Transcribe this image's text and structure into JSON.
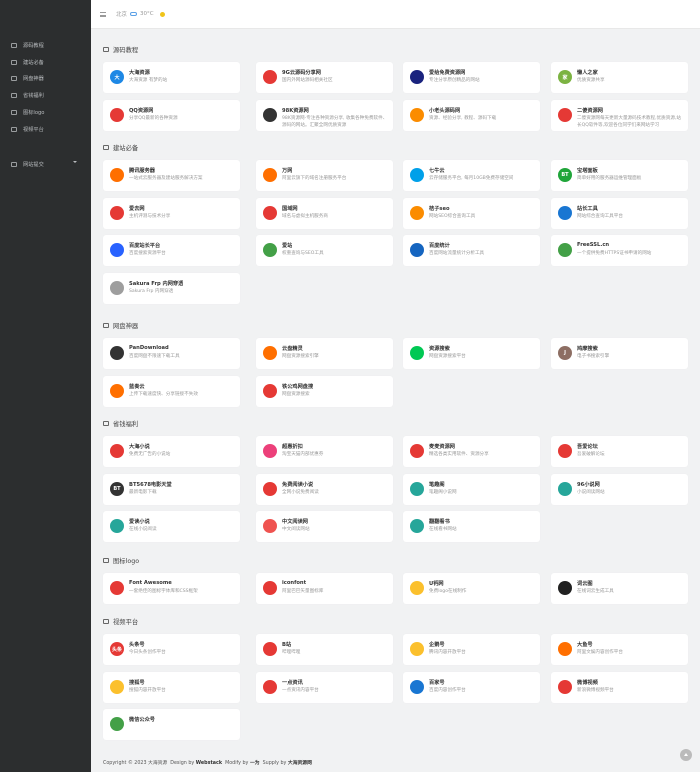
{
  "sidebar": {
    "items": [
      {
        "label": "源码教程",
        "icon": "book-icon"
      },
      {
        "label": "建站必备",
        "icon": "tools-icon"
      },
      {
        "label": "网盘神器",
        "icon": "cloud-icon"
      },
      {
        "label": "省钱福利",
        "icon": "money-icon"
      },
      {
        "label": "图标logo",
        "icon": "image-icon"
      },
      {
        "label": "视频平台",
        "icon": "video-icon"
      },
      {
        "label": "网站提交",
        "icon": "link-icon"
      }
    ]
  },
  "topbar": {
    "city": "北京",
    "temp": "30°C"
  },
  "sections": [
    {
      "title": "源码教程",
      "cards": [
        {
          "name": "大海资源",
          "desc": "大海资源 有梦的站",
          "logo": "大",
          "color": "#1e88e5"
        },
        {
          "name": "9G云源码分享网",
          "desc": "国内外网站源码相关社区",
          "logo": "",
          "color": "#e53935"
        },
        {
          "name": "爱给免费资源网",
          "desc": "专注分享原创精品的网站",
          "logo": "",
          "color": "#1a237e"
        },
        {
          "name": "懒人之家",
          "desc": "优质资源共享",
          "logo": "家",
          "color": "#7cb342"
        },
        {
          "name": "QQ资源网",
          "desc": "分享QQ最新的各种资源",
          "logo": "",
          "color": "#e53935"
        },
        {
          "name": "98K资源网",
          "desc": "98K资源网-专注各种资源分享, 收集各种免费软件、源码的网站。汇聚全网优质资源",
          "logo": "",
          "color": "#333333"
        },
        {
          "name": "小老头源码网",
          "desc": "资源、经验分享, 教程、源码下载",
          "logo": "",
          "color": "#fb8c00"
        },
        {
          "name": "二傻资源网",
          "desc": "二傻资源网每天更新大量源码技术教程,优质资源,站长QQ软件等,欢迎各位同学们来网站学习",
          "logo": "",
          "color": "#e53935"
        }
      ]
    },
    {
      "title": "建站必备",
      "cards": [
        {
          "name": "腾讯服务器",
          "desc": "一站式云服务器及建站服务解决方案",
          "logo": "",
          "color": "#ff6f00"
        },
        {
          "name": "万网",
          "desc": "阿里云旗下的域名注册服务平台",
          "logo": "",
          "color": "#ff6f00"
        },
        {
          "name": "七牛云",
          "desc": "云存储服务平台, 每月10GB免费存储空间",
          "logo": "",
          "color": "#00a0e9"
        },
        {
          "name": "宝塔面板",
          "desc": "简单好用的服务器运维管理面板",
          "logo": "BT",
          "color": "#20a53a"
        },
        {
          "name": "爱去网",
          "desc": "主机评测与技术分享",
          "logo": "",
          "color": "#e53935"
        },
        {
          "name": "国域网",
          "desc": "域名与虚拟主机服务商",
          "logo": "",
          "color": "#e53935"
        },
        {
          "name": "桔子seo",
          "desc": "网站SEO综合查询工具",
          "logo": "",
          "color": "#fb8c00"
        },
        {
          "name": "站长工具",
          "desc": "网站综合查询工具平台",
          "logo": "",
          "color": "#1976d2"
        },
        {
          "name": "百度站长平台",
          "desc": "百度搜索资源平台",
          "logo": "",
          "color": "#2962ff"
        },
        {
          "name": "爱站",
          "desc": "权重查询与SEO工具",
          "logo": "",
          "color": "#43a047"
        },
        {
          "name": "百度统计",
          "desc": "百度网站流量统计分析工具",
          "logo": "",
          "color": "#1565c0"
        },
        {
          "name": "FreeSSL.cn",
          "desc": "一个提供免费HTTPS证书申请的网站",
          "logo": "",
          "color": "#43a047"
        },
        {
          "name": "Sakura Frp 内网穿透",
          "desc": "Sakura Frp 内网穿透",
          "logo": "",
          "color": "#9e9e9e"
        }
      ]
    },
    {
      "title": "网盘神器",
      "cards": [
        {
          "name": "PanDownload",
          "desc": "百度网盘不限速下载工具",
          "logo": "",
          "color": "#333333"
        },
        {
          "name": "云盘精灵",
          "desc": "网盘资源搜索引擎",
          "logo": "",
          "color": "#ff6f00"
        },
        {
          "name": "资源搜索",
          "desc": "网盘资源搜索平台",
          "logo": "",
          "color": "#00c853"
        },
        {
          "name": "鸠摩搜索",
          "desc": "电子书搜索引擎",
          "logo": "J",
          "color": "#8d6e63"
        },
        {
          "name": "蓝奏云",
          "desc": "上传下载速度快、分享链接不失效",
          "logo": "",
          "color": "#ff6f00"
        },
        {
          "name": "铁公鸡网盘搜",
          "desc": "网盘资源搜索",
          "logo": "",
          "color": "#e53935"
        }
      ]
    },
    {
      "title": "省钱福利",
      "cards": [
        {
          "name": "大海小说",
          "desc": "免费无广告的小说站",
          "logo": "",
          "color": "#e53935"
        },
        {
          "name": "超惠折扣",
          "desc": "淘宝天猫内部优惠券",
          "logo": "",
          "color": "#ec407a"
        },
        {
          "name": "麦麦资源网",
          "desc": "精选各类实用软件、资源分享",
          "logo": "",
          "color": "#e53935"
        },
        {
          "name": "吾爱论坛",
          "desc": "吾爱破解论坛",
          "logo": "",
          "color": "#e53935"
        },
        {
          "name": "BT5678电影天堂",
          "desc": "最新电影下载",
          "logo": "BT",
          "color": "#333333"
        },
        {
          "name": "免费阅读小说",
          "desc": "全网小说免费阅读",
          "logo": "",
          "color": "#e53935"
        },
        {
          "name": "笔趣阁",
          "desc": "笔趣阁小说网",
          "logo": "",
          "color": "#26a69a"
        },
        {
          "name": "96小说网",
          "desc": "小说阅读网站",
          "logo": "",
          "color": "#26a69a"
        },
        {
          "name": "爱读小说",
          "desc": "在线小说阅读",
          "logo": "",
          "color": "#26a69a"
        },
        {
          "name": "中文阅读网",
          "desc": "中文阅读网站",
          "logo": "",
          "color": "#ef5350"
        },
        {
          "name": "翻翻看书",
          "desc": "在线看书网站",
          "logo": "",
          "color": "#26a69a"
        }
      ]
    },
    {
      "title": "图标logo",
      "cards": [
        {
          "name": "Font Awesome",
          "desc": "一套绝佳的图标字体库和CSS框架",
          "logo": "",
          "color": "#e53935"
        },
        {
          "name": "iconfont",
          "desc": "阿里巴巴矢量图标库",
          "logo": "",
          "color": "#e53935"
        },
        {
          "name": "U钙网",
          "desc": "免费logo在线制作",
          "logo": "",
          "color": "#fbc02d"
        },
        {
          "name": "词云图",
          "desc": "在线词云生成工具",
          "logo": "",
          "color": "#212121"
        }
      ]
    },
    {
      "title": "视频平台",
      "cards": [
        {
          "name": "头条号",
          "desc": "今日头条创作平台",
          "logo": "头条",
          "color": "#e53935"
        },
        {
          "name": "B站",
          "desc": "哔哩哔哩",
          "logo": "",
          "color": "#e53935"
        },
        {
          "name": "企鹅号",
          "desc": "腾讯内容开放平台",
          "logo": "",
          "color": "#fbc02d"
        },
        {
          "name": "大鱼号",
          "desc": "阿里文娱内容创作平台",
          "logo": "",
          "color": "#ff6f00"
        },
        {
          "name": "搜狐号",
          "desc": "搜狐内容开放平台",
          "logo": "",
          "color": "#fbc02d"
        },
        {
          "name": "一点资讯",
          "desc": "一点资讯内容平台",
          "logo": "",
          "color": "#e53935"
        },
        {
          "name": "百家号",
          "desc": "百度内容创作平台",
          "logo": "",
          "color": "#1976d2"
        },
        {
          "name": "微博视频",
          "desc": "新浪微博视频平台",
          "logo": "",
          "color": "#e53935"
        },
        {
          "name": "微信公众号",
          "desc": "",
          "logo": "",
          "color": "#43a047"
        }
      ]
    }
  ],
  "footer": {
    "prefix": "Copyright © 2023 大海资源",
    "design": "Design by",
    "design_name": "Webstack",
    "modify": "Modify by",
    "modify_name": "一为",
    "supply": "Supply by",
    "supply_name": "大海资源网"
  }
}
